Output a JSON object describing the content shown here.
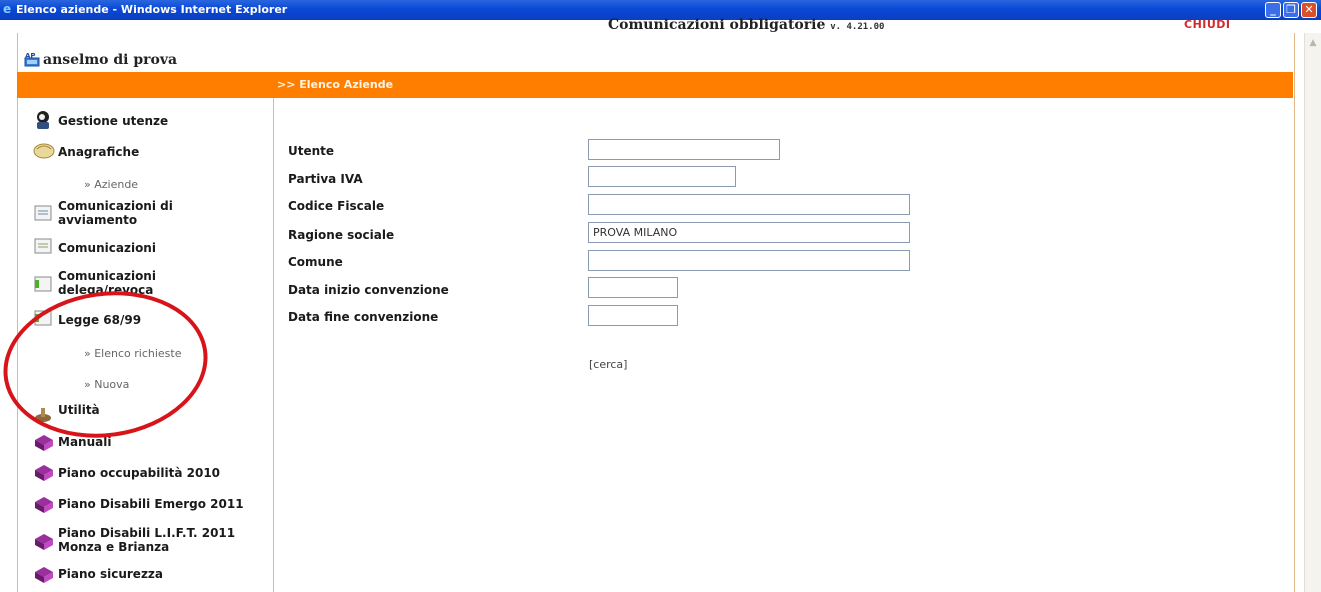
{
  "window": {
    "title": "Elenco aziende - Windows Internet Explorer",
    "min_glyph": "_",
    "max_glyph": "❐",
    "close_glyph": "✕"
  },
  "header": {
    "user_name": "anselmo di prova",
    "app_title": "Comunicazioni obbligatorie",
    "app_version": "v. 4.21.00",
    "close_label": "CHIUDI"
  },
  "breadcrumb": ">> Elenco Aziende",
  "sidebar": {
    "items": [
      {
        "label": "Gestione utenze",
        "icon": "user-admin-icon"
      },
      {
        "label": "Anagrafiche",
        "icon": "folder-icon",
        "subitems": [
          {
            "label": "» Aziende"
          }
        ]
      },
      {
        "label": "Comunicazioni di avviamento",
        "line1": "Comunicazioni di",
        "line2": "avviamento",
        "icon": "document-icon"
      },
      {
        "label": "Comunicazioni",
        "icon": "document-icon"
      },
      {
        "label": "Comunicazioni delega/revoca",
        "line1": "Comunicazioni",
        "line2": "delega/revoca",
        "icon": "document-icon"
      },
      {
        "label": "Legge 68/99",
        "icon": "document-icon",
        "subitems": [
          {
            "label": "» Elenco richieste"
          },
          {
            "label": "» Nuova"
          }
        ]
      },
      {
        "label": "Utilità",
        "icon": "tools-icon"
      },
      {
        "label": "Manuali",
        "icon": "book-icon"
      },
      {
        "label": "Piano occupabilità 2010",
        "icon": "book-icon"
      },
      {
        "label": "Piano Disabili Emergo 2011",
        "icon": "book-icon"
      },
      {
        "label": "Piano Disabili L.I.F.T. 2011 Monza e Brianza",
        "line1": "Piano Disabili L.I.F.T. 2011",
        "line2": "Monza e Brianza",
        "icon": "book-icon"
      },
      {
        "label": "Piano sicurezza",
        "icon": "book-icon"
      }
    ]
  },
  "form": {
    "fields": [
      {
        "label": "Utente",
        "value": ""
      },
      {
        "label": "Partiva IVA",
        "value": ""
      },
      {
        "label": "Codice Fiscale",
        "value": ""
      },
      {
        "label": "Ragione sociale",
        "value": "PROVA MILANO"
      },
      {
        "label": "Comune",
        "value": ""
      },
      {
        "label": "Data inizio convenzione",
        "value": ""
      },
      {
        "label": "Data fine convenzione",
        "value": ""
      }
    ],
    "search_label": "[cerca]"
  },
  "colors": {
    "accent": "#ff7e00",
    "close_link": "#d12a2a",
    "annotation": "#d7141a",
    "titlebar": "#0a48d6"
  }
}
